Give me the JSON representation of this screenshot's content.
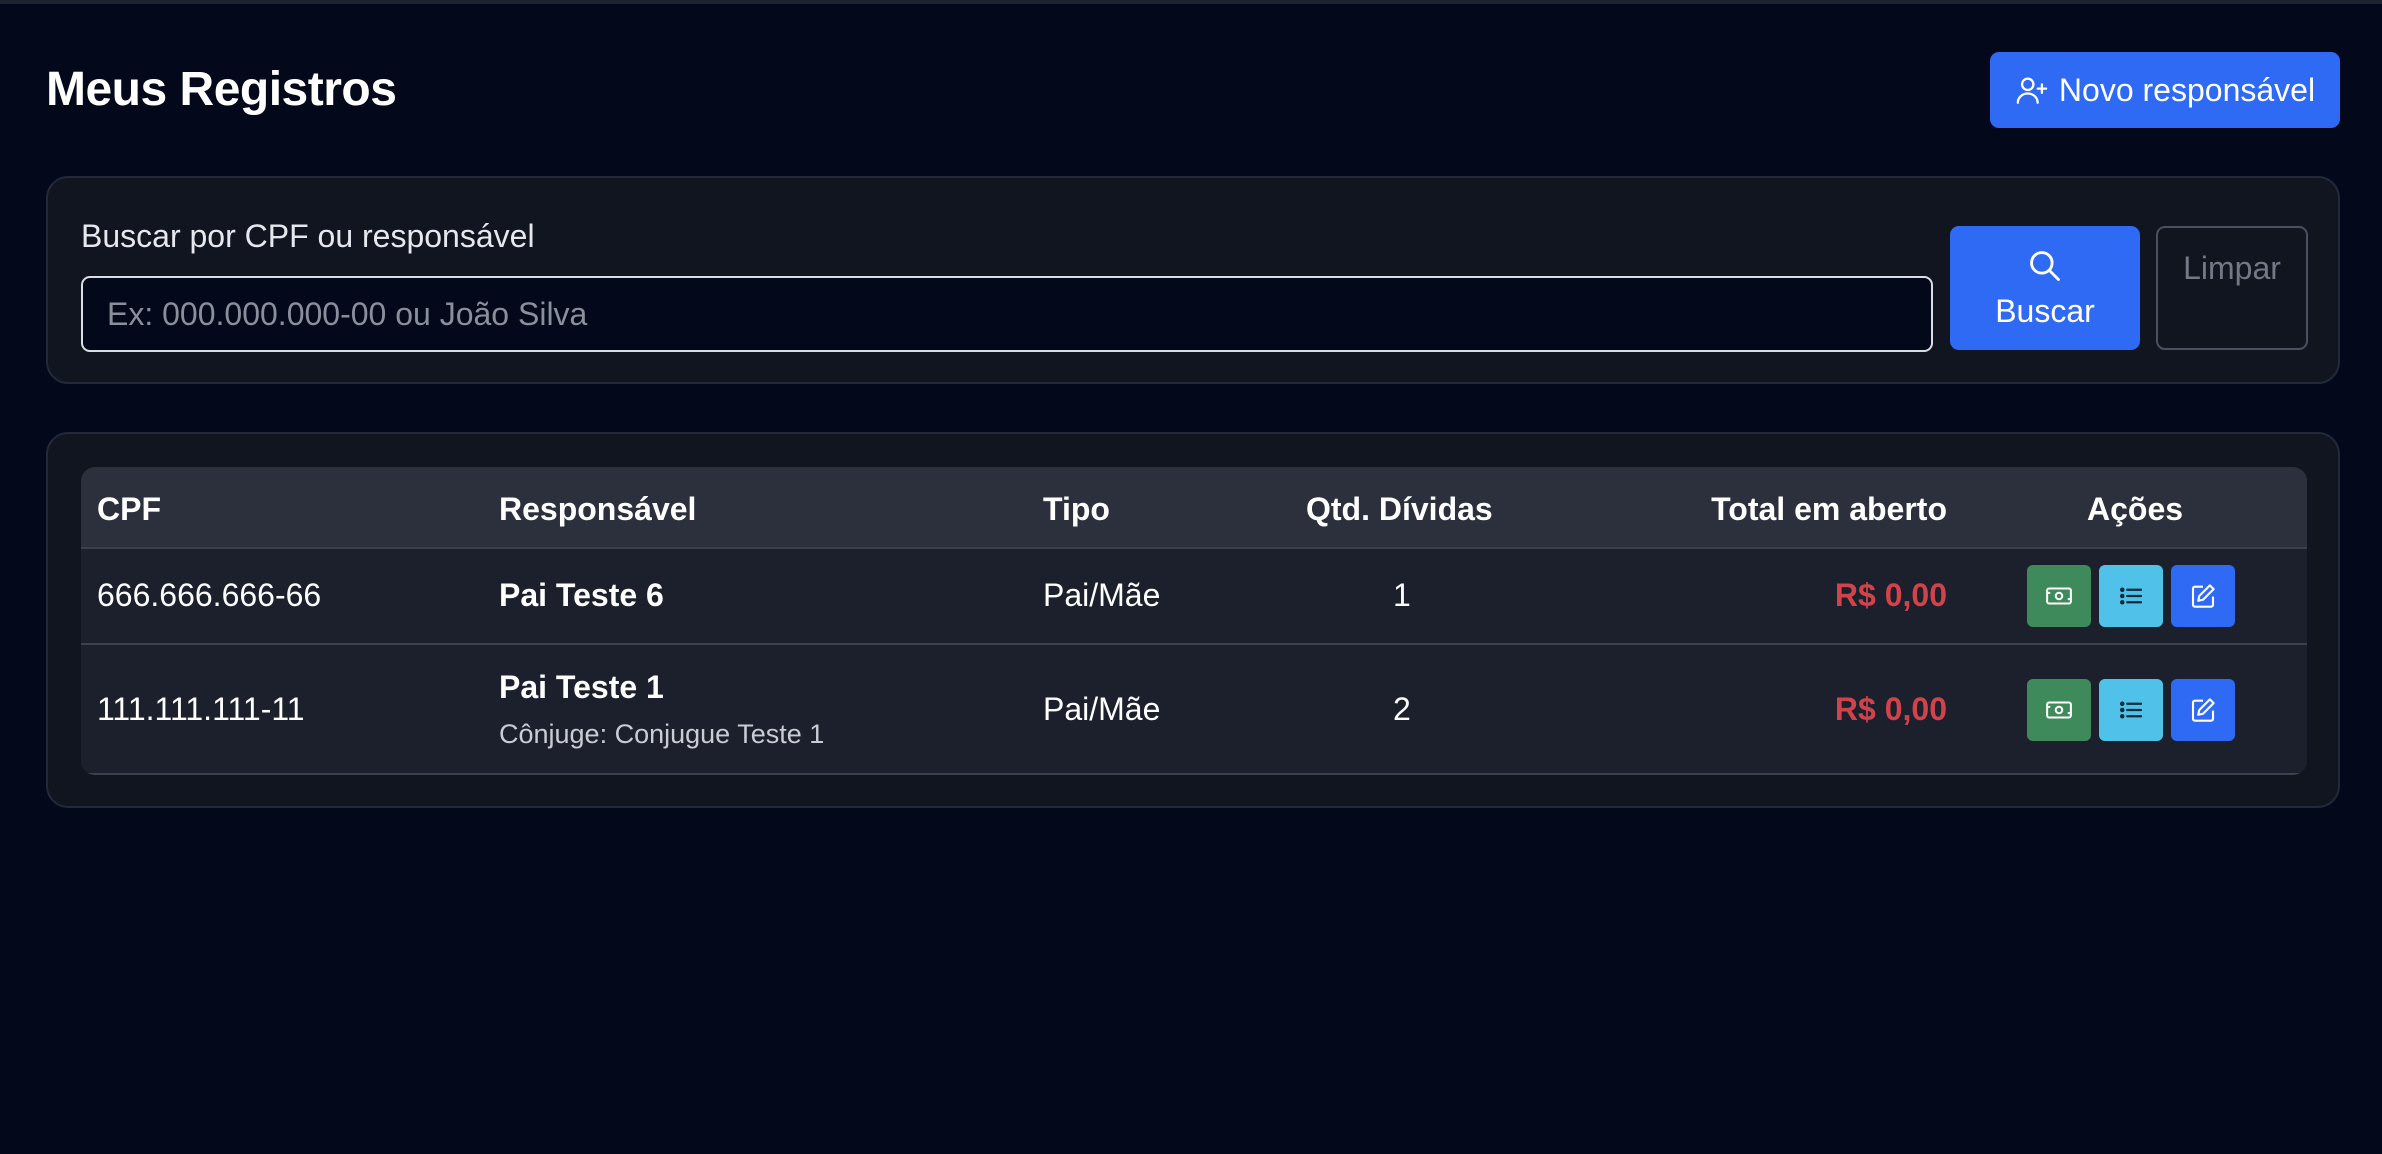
{
  "header": {
    "title": "Meus Registros",
    "new_button_label": "Novo responsável"
  },
  "search": {
    "label": "Buscar por CPF ou responsável",
    "placeholder": "Ex: 000.000.000-00 ou João Silva",
    "value": "",
    "search_button_label": "Buscar",
    "clear_button_label": "Limpar"
  },
  "table": {
    "columns": [
      "CPF",
      "Responsável",
      "Tipo",
      "Qtd. Dívidas",
      "Total em aberto",
      "Ações"
    ],
    "rows": [
      {
        "cpf": "666.666.666-66",
        "responsavel": "Pai Teste 6",
        "conjuge": "",
        "tipo": "Pai/Mãe",
        "qtd_dividas": "1",
        "total": "R$ 0,00"
      },
      {
        "cpf": "111.111.111-11",
        "responsavel": "Pai Teste 1",
        "conjuge": "Cônjuge: Conjugue Teste 1",
        "tipo": "Pai/Mãe",
        "qtd_dividas": "2",
        "total": "R$ 0,00"
      }
    ]
  },
  "colors": {
    "background": "#03081a",
    "card": "#11151f",
    "primary": "#2f6af5",
    "success": "#3f8a5a",
    "info": "#50c2ea",
    "danger_text": "#d1434b"
  },
  "icons": {
    "new_button": "user-plus-icon",
    "search_button": "search-icon",
    "row_actions": [
      "cash-icon",
      "list-icon",
      "edit-icon"
    ]
  }
}
